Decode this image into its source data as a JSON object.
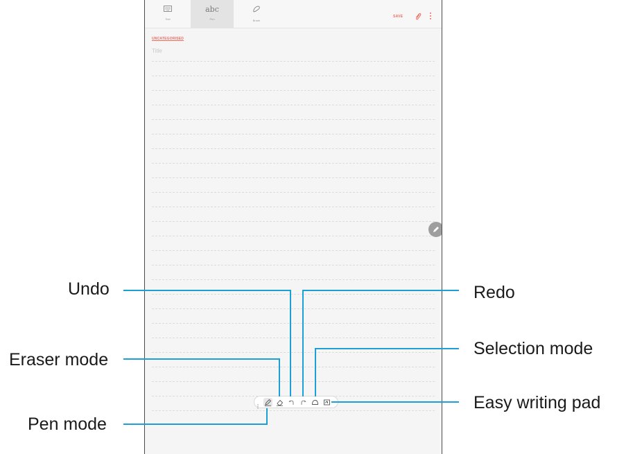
{
  "toolbar": {
    "tabs": [
      {
        "icon": "keyboard-icon",
        "label": "Text",
        "active": false
      },
      {
        "icon": "handwriting-icon",
        "icon_text": "abc",
        "label": "Pen",
        "active": true
      },
      {
        "icon": "brush-icon",
        "label": "Brush",
        "active": false
      }
    ],
    "save_label": "SAVE",
    "attach_icon": "paperclip-icon",
    "more_icon": "more-vertical-icon"
  },
  "note": {
    "category": "UNCATEGORISED",
    "title_placeholder": "Title"
  },
  "pen_toolbar": {
    "tools": [
      {
        "name": "pen-mode-icon",
        "active": true
      },
      {
        "name": "eraser-mode-icon",
        "active": false
      },
      {
        "name": "undo-icon",
        "active": false
      },
      {
        "name": "redo-icon",
        "active": false
      },
      {
        "name": "selection-mode-icon",
        "active": false
      },
      {
        "name": "easy-writing-pad-icon",
        "active": false
      }
    ]
  },
  "callouts": {
    "undo": "Undo",
    "redo": "Redo",
    "eraser_mode": "Eraser mode",
    "selection_mode": "Selection mode",
    "pen_mode": "Pen mode",
    "easy_writing_pad": "Easy writing pad"
  },
  "colors": {
    "accent": "#f26b5b",
    "leader_line": "#1a9fd6",
    "fab": "#9e9e9e"
  }
}
